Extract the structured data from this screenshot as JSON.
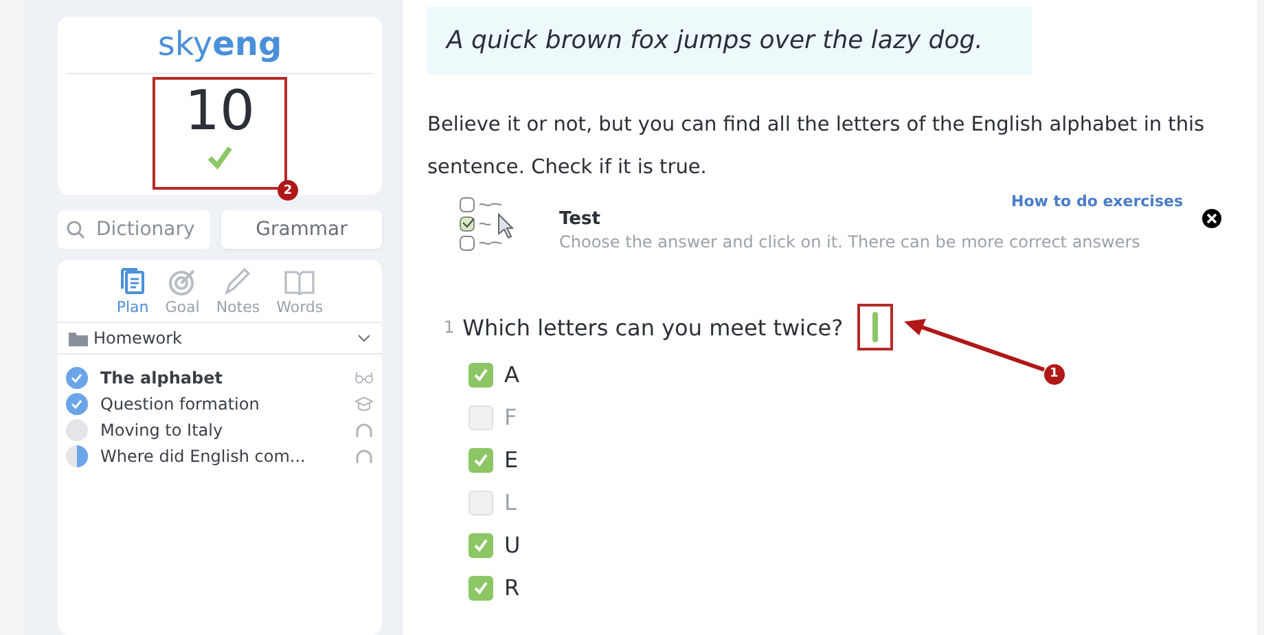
{
  "sidebar": {
    "logo": {
      "light": "sky",
      "bold": "eng"
    },
    "score": {
      "value": "10",
      "correct": true,
      "badge": "2"
    },
    "dictionary": {
      "placeholder": "Dictionary"
    },
    "grammar_button": "Grammar",
    "tabs": [
      {
        "label": "Plan",
        "selected": true
      },
      {
        "label": "Goal",
        "selected": false
      },
      {
        "label": "Notes",
        "selected": false
      },
      {
        "label": "Words",
        "selected": false
      }
    ],
    "section": {
      "title": "Homework",
      "expanded": true
    },
    "lessons": [
      {
        "title": "The alphabet",
        "level": 1,
        "kind": "reading",
        "selected": true
      },
      {
        "title": "Question formation",
        "level": 1,
        "kind": "grammar",
        "selected": false
      },
      {
        "title": "Moving to Italy",
        "level": 0,
        "kind": "listening",
        "selected": false
      },
      {
        "title": "Where did English com...",
        "level": 0.5,
        "kind": "listening",
        "selected": false
      }
    ]
  },
  "main": {
    "quote": "A quick brown fox jumps over the lazy dog.",
    "paragraph": "Believe it or not, but you can find all the letters of the English alphabet in this sentence. Check if it is true.",
    "exercise": {
      "title": "Test",
      "hint": "Choose the answer and click on it. There can be more correct answers",
      "help_link": "How to do exercises"
    },
    "question": {
      "number": "1",
      "text": "Which letters can you meet twice?",
      "answered": true,
      "badge": "1",
      "options": [
        {
          "label": "A",
          "checked": true
        },
        {
          "label": "F",
          "checked": false
        },
        {
          "label": "E",
          "checked": true
        },
        {
          "label": "L",
          "checked": false
        },
        {
          "label": "U",
          "checked": true
        },
        {
          "label": "R",
          "checked": true
        }
      ]
    }
  }
}
